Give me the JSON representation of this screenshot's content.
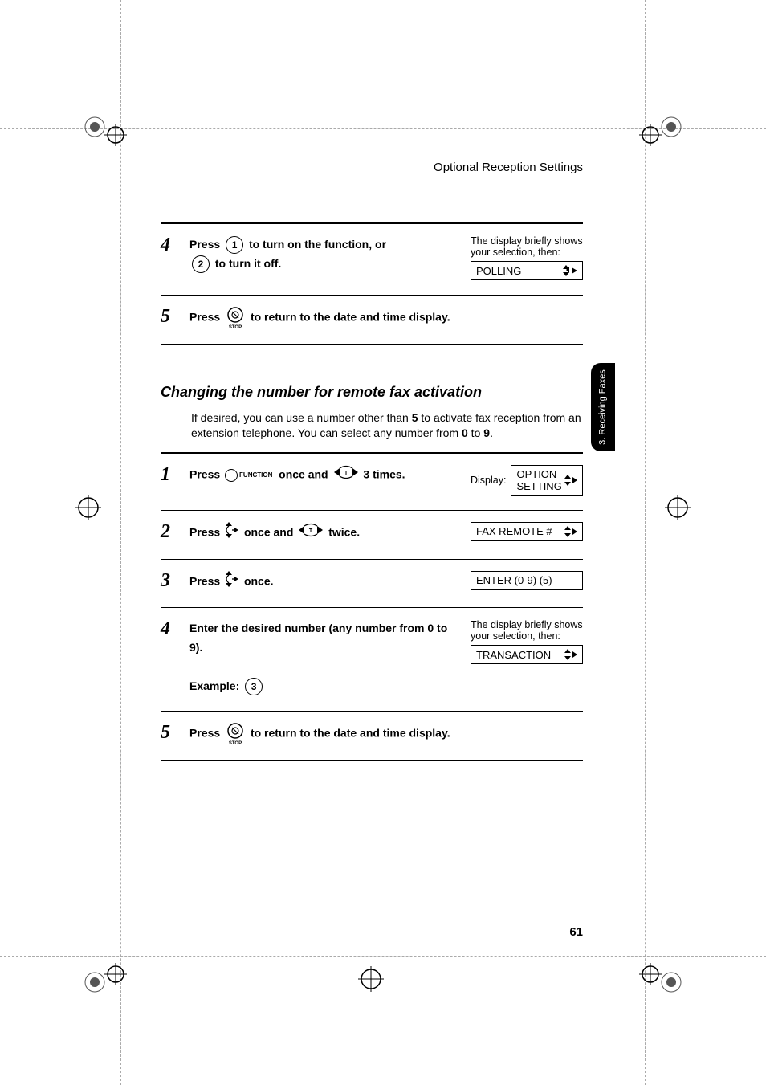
{
  "header": {
    "section_title": "Optional Reception Settings"
  },
  "side_tab": "3. Receiving\nFaxes",
  "page_number": "61",
  "top_steps": {
    "s4": {
      "press": "Press",
      "key1": "1",
      "to_on": "to turn on the function, or",
      "key2": "2",
      "to_off": "to turn it off.",
      "side_note": "The display briefly shows your selection, then:",
      "display": "POLLING"
    },
    "s5": {
      "press": "Press",
      "stop_label": "STOP",
      "rest": "to return to the date and time display."
    }
  },
  "subsection": {
    "title": "Changing the number for remote fax activation",
    "intro_a": "If desired, you can use a number other than ",
    "intro_b": "5",
    "intro_c": " to activate fax reception from an extension telephone. You can select any number from ",
    "intro_d": "0",
    "intro_e": " to ",
    "intro_f": "9",
    "intro_g": "."
  },
  "steps": {
    "s1": {
      "press": "Press",
      "function": "FUNCTION",
      "once_and": "once and",
      "times": "3 times.",
      "disp_label": "Display:",
      "display": "OPTION SETTING"
    },
    "s2": {
      "press": "Press",
      "once_and": "once and",
      "twice": "twice.",
      "display": "FAX REMOTE #"
    },
    "s3": {
      "press": "Press",
      "once": "once.",
      "display": "ENTER (0-9) (5)"
    },
    "s4": {
      "text": "Enter the desired number (any number from 0 to 9).",
      "example_label": "Example:",
      "example_key": "3",
      "side_note": "The display briefly shows your selection, then:",
      "display": "TRANSACTION"
    },
    "s5": {
      "press": "Press",
      "stop_label": "STOP",
      "rest": "to return to the date and time display."
    }
  }
}
